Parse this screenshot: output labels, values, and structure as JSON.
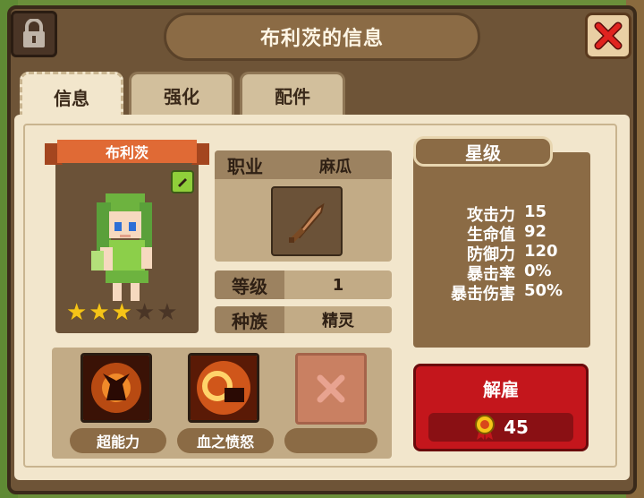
{
  "window": {
    "title": "布利茨的信息"
  },
  "tabs": [
    {
      "label": "信息",
      "active": true
    },
    {
      "label": "强化",
      "active": false
    },
    {
      "label": "配件",
      "active": false
    }
  ],
  "character": {
    "name": "布利茨",
    "stars_filled": 3,
    "stars_total": 5,
    "job_label": "职业",
    "job_value": "麻瓜",
    "level_label": "等级",
    "level_value": "1",
    "race_label": "种族",
    "race_value": "精灵"
  },
  "skills": [
    {
      "label": "超能力",
      "icon": "demon-power-icon"
    },
    {
      "label": "血之愤怒",
      "icon": "ram-rage-icon"
    },
    {
      "label": "",
      "icon": "empty-slot-x-icon"
    }
  ],
  "stats": {
    "header": "星级",
    "rows": [
      {
        "name": "攻击力",
        "value": "15"
      },
      {
        "name": "生命值",
        "value": "92"
      },
      {
        "name": "防御力",
        "value": "120"
      },
      {
        "name": "暴击率",
        "value": "0%"
      },
      {
        "name": "暴击伤害",
        "value": "50%"
      }
    ]
  },
  "dismiss": {
    "label": "解雇",
    "cost": "45",
    "cost_icon": "medal-icon"
  },
  "colors": {
    "accent_red": "#c4161c",
    "panel_brown": "#6e5437",
    "parchment": "#f2e6cc"
  }
}
